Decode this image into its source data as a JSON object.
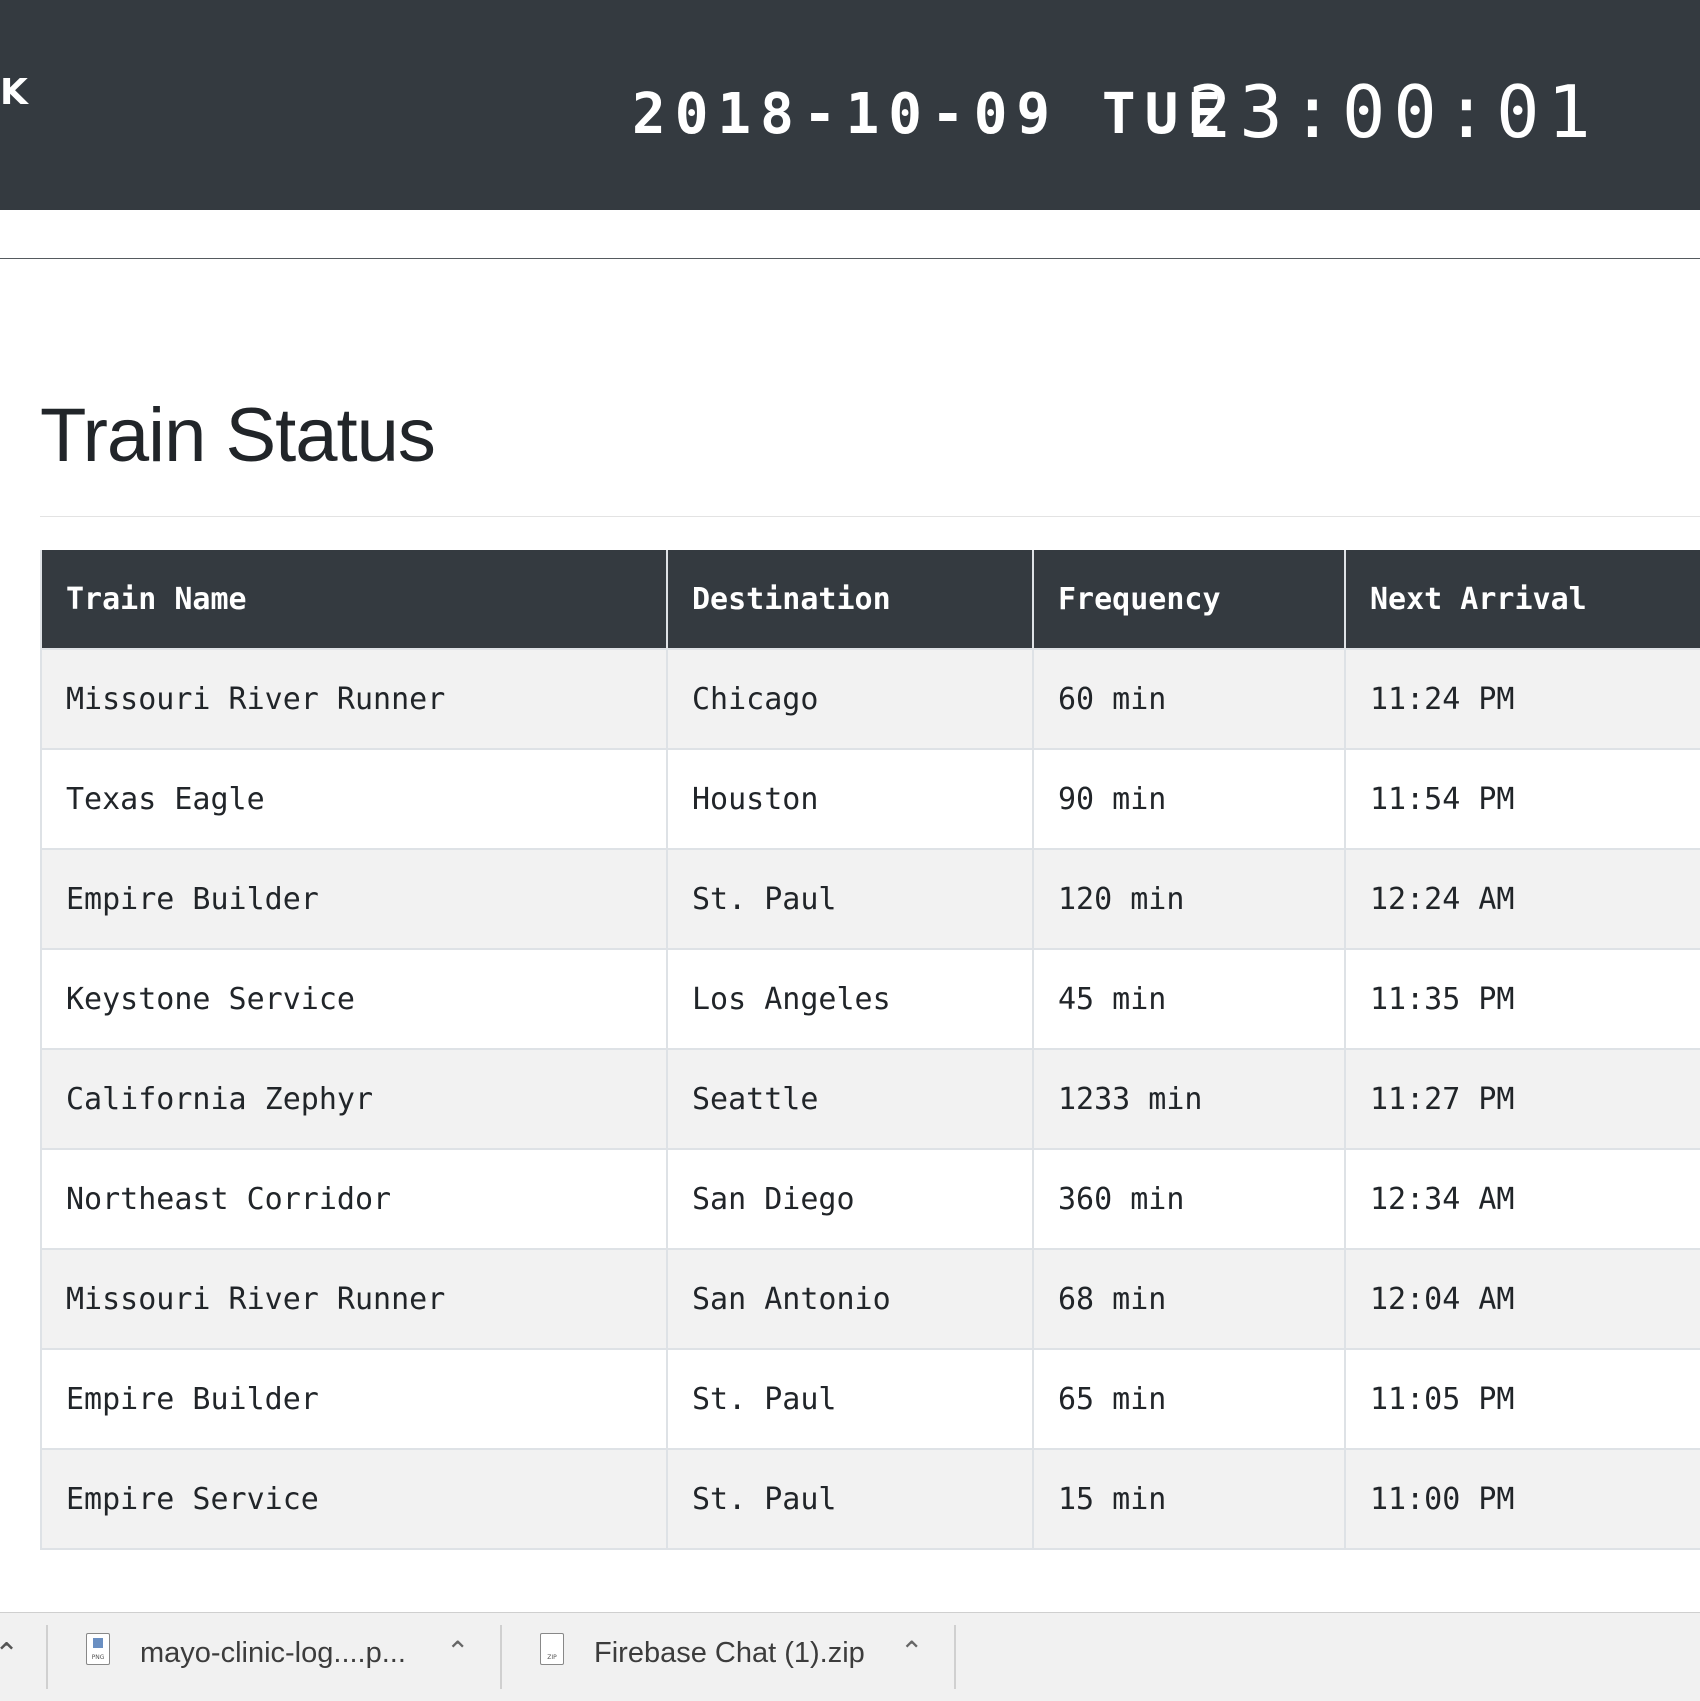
{
  "header": {
    "logo_text": "K",
    "clock_date": "2018-10-09 TUE",
    "clock_time": "23:00:01"
  },
  "page": {
    "title": "Train Status"
  },
  "table": {
    "columns": [
      "Train Name",
      "Destination",
      "Frequency",
      "Next Arrival"
    ],
    "rows": [
      [
        "Missouri River Runner",
        "Chicago",
        "60 min",
        "11:24 PM"
      ],
      [
        "Texas Eagle",
        "Houston",
        "90 min",
        "11:54 PM"
      ],
      [
        "Empire Builder",
        "St. Paul",
        "120 min",
        "12:24 AM"
      ],
      [
        "Keystone Service",
        "Los Angeles",
        "45 min",
        "11:35 PM"
      ],
      [
        "California Zephyr",
        "Seattle",
        "1233 min",
        "11:27 PM"
      ],
      [
        "Northeast Corridor",
        "San Diego",
        "360 min",
        "12:34 AM"
      ],
      [
        "Missouri River Runner",
        "San Antonio",
        "68 min",
        "12:04 AM"
      ],
      [
        "Empire Builder",
        "St. Paul",
        "65 min",
        "11:05 PM"
      ],
      [
        "Empire Service",
        "St. Paul",
        "15 min",
        "11:00 PM"
      ]
    ]
  },
  "downloads": {
    "items": [
      {
        "name": "mayo-clinic-log....p...",
        "file_type": "PNG",
        "icon": "png-file-icon"
      },
      {
        "name": "Firebase Chat (1).zip",
        "file_type": "ZIP",
        "icon": "zip-file-icon"
      }
    ],
    "chevron_icon": "chevron-up-icon"
  },
  "colors": {
    "header_bg": "#343a40",
    "table_header_bg": "#343a40",
    "row_stripe": "#f2f2f2",
    "border": "#dee2e6"
  }
}
